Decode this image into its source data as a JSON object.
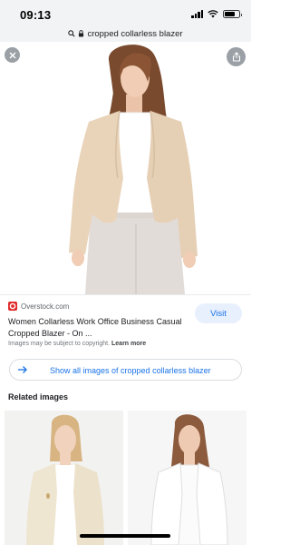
{
  "status_bar": {
    "time": "09:13"
  },
  "url_bar": {
    "query": "cropped collarless blazer"
  },
  "viewer": {
    "image": "Woman wearing beige cropped collarless blazer and light pants"
  },
  "result": {
    "source": "Overstock.com",
    "title": "Women Collarless Work Office Business Casual Cropped Blazer - On ...",
    "visit_label": "Visit",
    "copyright_text": "Images may be subject to copyright.",
    "learn_more": "Learn more"
  },
  "show_all": {
    "label": "Show all images of cropped collarless blazer"
  },
  "related": {
    "heading": "Related images",
    "items": [
      {
        "image": "Woman in cream cropped blazer"
      },
      {
        "image": "Woman in white cropped blazer"
      }
    ]
  },
  "colors": {
    "accent": "#1a73e8",
    "visit_bg": "#e8f0fe",
    "source_logo": "#e02a2a"
  }
}
